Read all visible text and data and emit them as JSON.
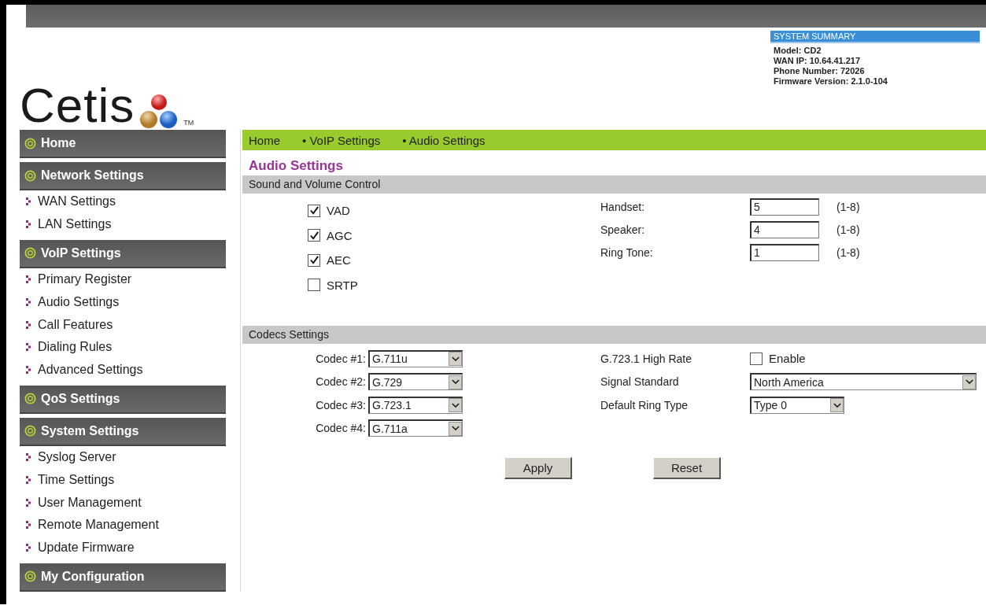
{
  "logo": {
    "text": "Cetis",
    "trademark": "TM"
  },
  "system_summary": {
    "title": "SYSTEM SUMMARY",
    "lines": [
      {
        "label": "Model:",
        "value": "CD2"
      },
      {
        "label": "WAN IP:",
        "value": "10.64.41.217"
      },
      {
        "label": "Phone Number:",
        "value": "72026"
      },
      {
        "label": "Firmware Version:",
        "value": "2.1.0-104"
      }
    ]
  },
  "sidebar": {
    "sections": [
      {
        "title": "Home"
      },
      {
        "title": "Network Settings",
        "items": [
          {
            "label": "WAN Settings"
          },
          {
            "label": "LAN Settings"
          }
        ]
      },
      {
        "title": "VoIP Settings",
        "items": [
          {
            "label": "Primary Register"
          },
          {
            "label": "Audio Settings"
          },
          {
            "label": "Call Features"
          },
          {
            "label": "Dialing Rules"
          },
          {
            "label": "Advanced Settings"
          }
        ]
      },
      {
        "title": "QoS Settings"
      },
      {
        "title": "System Settings",
        "items": [
          {
            "label": "Syslog Server"
          },
          {
            "label": "Time Settings"
          },
          {
            "label": "User Management"
          },
          {
            "label": "Remote Management"
          },
          {
            "label": "Update Firmware"
          }
        ]
      },
      {
        "title": "My Configuration"
      }
    ]
  },
  "breadcrumb": [
    "Home",
    "• VoIP Settings",
    "• Audio Settings"
  ],
  "page_title": "Audio Settings",
  "sound_section": {
    "title": "Sound and Volume Control",
    "options": [
      {
        "label": "VAD",
        "checked": true
      },
      {
        "label": "AGC",
        "checked": true
      },
      {
        "label": "AEC",
        "checked": true
      },
      {
        "label": "SRTP",
        "checked": false
      }
    ],
    "volumes": [
      {
        "label": "Handset:",
        "value": "5",
        "range": "(1-8)"
      },
      {
        "label": "Speaker:",
        "value": "4",
        "range": "(1-8)"
      },
      {
        "label": "Ring Tone:",
        "value": "1",
        "range": "(1-8)"
      }
    ]
  },
  "codecs_section": {
    "title": "Codecs Settings",
    "codecs": [
      {
        "label": "Codec #1:",
        "value": "G.711u"
      },
      {
        "label": "Codec #2:",
        "value": "G.729"
      },
      {
        "label": "Codec #3:",
        "value": "G.723.1"
      },
      {
        "label": "Codec #4:",
        "value": "G.711a"
      }
    ],
    "settings": [
      {
        "kind": "checkbox",
        "label": "G.723.1 High Rate",
        "option": "Enable",
        "checked": false
      },
      {
        "kind": "select",
        "label": "Signal Standard",
        "value": "North America",
        "wide": true
      },
      {
        "kind": "select",
        "label": "Default Ring Type",
        "value": "Type 0",
        "wide": false
      }
    ]
  },
  "buttons": [
    "Apply",
    "Reset"
  ]
}
